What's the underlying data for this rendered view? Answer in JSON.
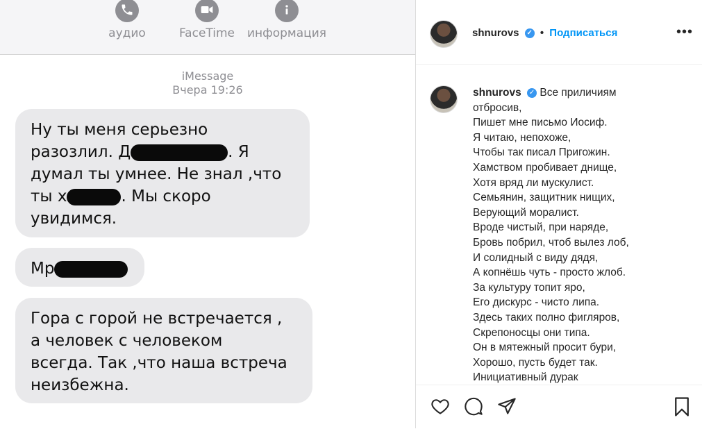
{
  "imessage": {
    "header": {
      "audio_label": "аудио",
      "facetime_label": "FaceTime",
      "info_label": "информация"
    },
    "service": "iMessage",
    "timestamp": "Вчера 19:26",
    "bubble1": {
      "line1": "Ну ты меня серьезно",
      "line2_a": "разозлил. Д",
      "line2_b": ". Я",
      "line3": "думал ты умнее. Не знал ,что",
      "line4_a": "ты х",
      "line4_b": ". Мы скоро",
      "line5": "увидимся."
    },
    "bubble2": {
      "text_a": "Мр"
    },
    "bubble3": {
      "line1": "Гора с горой не встречается ,",
      "line2": "а человек с человеком",
      "line3": "всегда. Так ,что наша встреча",
      "line4": "неизбежна."
    }
  },
  "instagram": {
    "username": "shnurovs",
    "separator": "•",
    "follow_label": "Подписаться",
    "more_label": "•••",
    "caption_first": "Все приличиям",
    "caption_lines": [
      "отбросив,",
      "Пишет мне письмо Иосиф.",
      "Я читаю, непохоже,",
      "Чтобы так писал Пригожин.",
      "Хамством пробивает днище,",
      "Хотя вряд ли мускулист.",
      "Семьянин, защитник нищих,",
      "Верующий моралист.",
      "Вроде чистый, при наряде,",
      "Бровь побрил, чтоб вылез лоб,",
      "И солидный с виду дядя,",
      "А копнёшь чуть - просто жлоб.",
      "За культуру топит яро,",
      "Его дискурс - чисто липа.",
      "Здесь таких полно фигляров,",
      "Скрепоносцы они типа.",
      "Он в мятежный просит бури,",
      "Хорошо, пусть будет так.",
      "Инициативный дурак"
    ],
    "icons": {
      "like": "heart-icon",
      "comment": "comment-icon",
      "share": "paper-plane-icon",
      "save": "bookmark-icon"
    }
  }
}
